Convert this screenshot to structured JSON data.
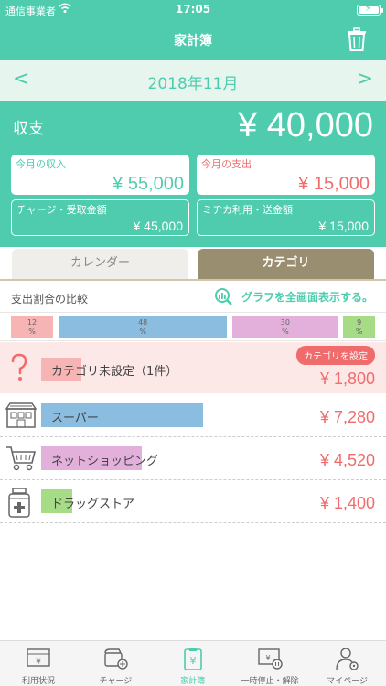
{
  "status": {
    "carrier": "通信事業者",
    "time": "17:05"
  },
  "nav": {
    "title": "家計簿"
  },
  "month": {
    "label": "2018年11月",
    "prev": "<",
    "next": ">"
  },
  "summary": {
    "label": "収支",
    "total": "¥ 40,000",
    "income_label": "今月の収入",
    "income_value": "¥ 55,000",
    "expense_label": "今月の支出",
    "expense_value": "¥ 15,000",
    "charge_label": "チャージ・受取金額",
    "charge_value": "¥ 45,000",
    "mijika_label": "ミヂカ利用・送金額",
    "mijika_value": "¥ 15,000"
  },
  "tabs": {
    "calendar": "カレンダー",
    "category": "カテゴリ"
  },
  "ratio": {
    "title": "支出割合の比較",
    "fullscreen_link": "グラフを全画面表示する。",
    "segments": [
      {
        "pct": "12",
        "unit": "%",
        "fraction": 0.12,
        "color": "#f7b4b4"
      },
      {
        "pct": "48",
        "unit": "%",
        "fraction": 0.48,
        "color": "#8bbde0"
      },
      {
        "pct": "30",
        "unit": "%",
        "fraction": 0.3,
        "color": "#e3b0dc"
      },
      {
        "pct": "9",
        "unit": "%",
        "fraction": 0.09,
        "color": "#a6dc86"
      }
    ]
  },
  "rows": [
    {
      "name": "カテゴリ未設定（1件）",
      "amount": "¥ 1,800",
      "badge": "カテゴリを設定",
      "icon": "question-icon",
      "color": "#f7b4b4",
      "fraction": 0.25
    },
    {
      "name": "スーパー",
      "amount": "¥ 7,280",
      "icon": "supermarket-icon",
      "color": "#8bbde0",
      "fraction": 1.0
    },
    {
      "name": "ネットショッピング",
      "amount": "¥ 4,520",
      "icon": "cart-icon",
      "color": "#e3b0dc",
      "fraction": 0.62
    },
    {
      "name": "ドラッグストア",
      "amount": "¥ 1,400",
      "icon": "medicine-icon",
      "color": "#a6dc86",
      "fraction": 0.19
    }
  ],
  "tabbar": [
    {
      "label": "利用状況",
      "icon": "card-icon"
    },
    {
      "label": "チャージ",
      "icon": "wallet-plus-icon"
    },
    {
      "label": "家計簿",
      "icon": "clipboard-yen-icon",
      "active": true
    },
    {
      "label": "一時停止・解除",
      "icon": "card-pause-icon"
    },
    {
      "label": "マイページ",
      "icon": "user-gear-icon"
    }
  ],
  "colors": {
    "accent": "#4fccae",
    "expense": "#f06c6c",
    "tab_active": "#9a8e70"
  }
}
